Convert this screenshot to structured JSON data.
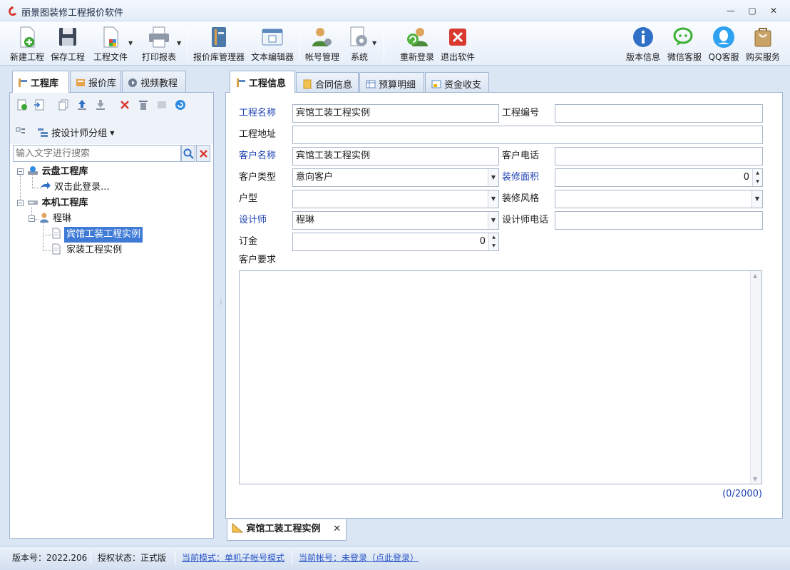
{
  "window": {
    "title": "丽景图装修工程报价软件",
    "controls": {
      "minimize": "—",
      "maximize": "▢",
      "close": "✕"
    }
  },
  "toolbar": {
    "items": [
      {
        "label": "新建工程",
        "icon": "new-project-icon"
      },
      {
        "label": "保存工程",
        "icon": "save-icon"
      },
      {
        "label": "工程文件",
        "icon": "project-file-icon"
      },
      {
        "label": "打印报表",
        "icon": "printer-icon"
      },
      {
        "label": "报价库管理器",
        "icon": "quote-library-icon"
      },
      {
        "label": "文本编辑器",
        "icon": "text-editor-icon"
      },
      {
        "label": "帐号管理",
        "icon": "account-icon"
      },
      {
        "label": "系统",
        "icon": "system-gear-icon"
      },
      {
        "label": "重新登录",
        "icon": "relogin-icon"
      },
      {
        "label": "退出软件",
        "icon": "exit-icon"
      },
      {
        "label": "版本信息",
        "icon": "info-icon"
      },
      {
        "label": "微信客服",
        "icon": "wechat-icon"
      },
      {
        "label": "QQ客服",
        "icon": "qq-icon"
      },
      {
        "label": "购买服务",
        "icon": "shopping-bag-icon"
      }
    ]
  },
  "left_panel": {
    "tabs": [
      {
        "label": "工程库",
        "active": true
      },
      {
        "label": "报价库",
        "active": false
      },
      {
        "label": "视频教程",
        "active": false
      }
    ],
    "group_by_label": "按设计师分组",
    "search_placeholder": "输入文字进行搜索",
    "tree": {
      "cloud_root": "云盘工程库",
      "cloud_login": "双击此登录...",
      "local_root": "本机工程库",
      "designer": "程琳",
      "projects": [
        {
          "label": "宾馆工装工程实例",
          "selected": true
        },
        {
          "label": "家装工程实例",
          "selected": false
        }
      ]
    }
  },
  "right_panel": {
    "tabs": [
      {
        "label": "工程信息",
        "active": true
      },
      {
        "label": "合同信息",
        "active": false
      },
      {
        "label": "预算明细",
        "active": false
      },
      {
        "label": "资金收支",
        "active": false
      }
    ],
    "form": {
      "project_name_label": "工程名称",
      "project_name_value": "宾馆工装工程实例",
      "project_no_label": "工程编号",
      "project_no_value": "",
      "address_label": "工程地址",
      "address_value": "",
      "customer_name_label": "客户名称",
      "customer_name_value": "宾馆工装工程实例",
      "customer_phone_label": "客户电话",
      "customer_phone_value": "",
      "customer_type_label": "客户类型",
      "customer_type_value": "意向客户",
      "area_label": "装修面积",
      "area_value": "0",
      "house_type_label": "户型",
      "house_type_value": "",
      "style_label": "装修风格",
      "style_value": "",
      "designer_label": "设计师",
      "designer_value": "程琳",
      "designer_phone_label": "设计师电话",
      "designer_phone_value": "",
      "deposit_label": "订金",
      "deposit_value": "0",
      "requirements_label": "客户要求",
      "requirements_value": "",
      "char_counter": "(0/2000)"
    }
  },
  "document_tab": {
    "label": "宾馆工装工程实例",
    "close": "✕"
  },
  "statusbar": {
    "version": "版本号：2022.206",
    "license": "授权状态：正式版",
    "mode": "当前模式：单机子帐号模式",
    "account": "当前帐号：未登录（点此登录）"
  },
  "colors": {
    "accent": "#3f7bd6",
    "required_label": "#1a3fb3",
    "link": "#2a55c5"
  }
}
